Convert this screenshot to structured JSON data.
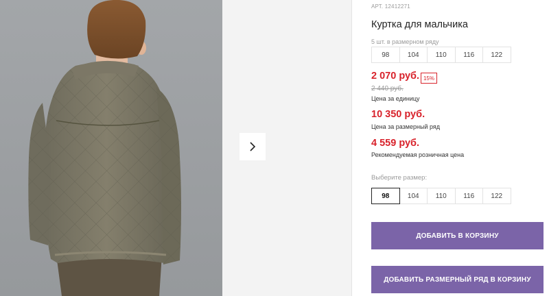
{
  "gallery": {
    "next_icon": "chevron-right-icon"
  },
  "product": {
    "article": "АРТ. 12412271",
    "title": "Куртка для мальчика",
    "series_label": "5 шт. в размерном ряду",
    "series_sizes": [
      "98",
      "104",
      "110",
      "116",
      "122"
    ],
    "price": "2 070 руб.",
    "discount": "15%",
    "old_price": "2 440 руб.",
    "price_caption": "Цена за единицу",
    "series_price": "10 350 руб.",
    "series_caption": "Цена за размерный ряд",
    "retail_price": "4 559 руб.",
    "retail_caption": "Рекомендуемая розничная цена",
    "choose_size_label": "Выберите размер:",
    "sizes": [
      "98",
      "104",
      "110",
      "116",
      "122"
    ],
    "selected_size": "98"
  },
  "actions": {
    "add_to_cart": "ДОБАВИТЬ В КОРЗИНУ",
    "add_series_to_cart": "ДОБАВИТЬ РАЗМЕРНЫЙ РЯД В КОРЗИНУ"
  },
  "colors": {
    "accent_button": "#7b64a8",
    "price_red": "#d8222b"
  }
}
